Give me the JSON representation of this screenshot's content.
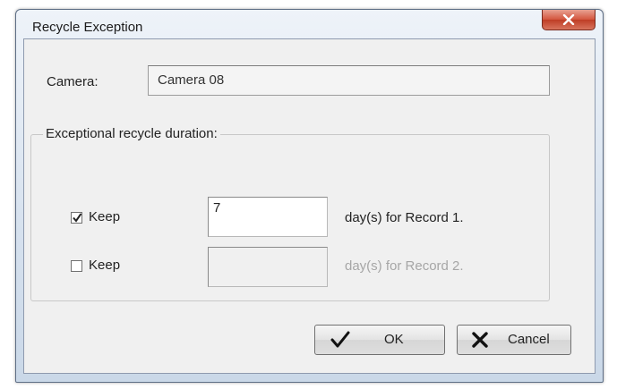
{
  "window": {
    "title": "Recycle Exception",
    "close_label": "×"
  },
  "camera": {
    "label": "Camera:",
    "value": "Camera 08"
  },
  "recycle": {
    "group_label": "Exceptional recycle duration:",
    "rows": [
      {
        "checked": true,
        "checkbox_label": "Keep",
        "days_value": "7",
        "suffix": "day(s) for Record 1.",
        "enabled": true
      },
      {
        "checked": false,
        "checkbox_label": "Keep",
        "days_value": "",
        "suffix": "day(s) for Record 2.",
        "enabled": false
      }
    ]
  },
  "buttons": {
    "ok_label": "OK",
    "ok_icon": "check-icon",
    "cancel_label": "Cancel",
    "cancel_icon": "x-mark-icon"
  },
  "colors": {
    "close_button": "#c9452f",
    "disabled_text": "#a6a6a6"
  }
}
